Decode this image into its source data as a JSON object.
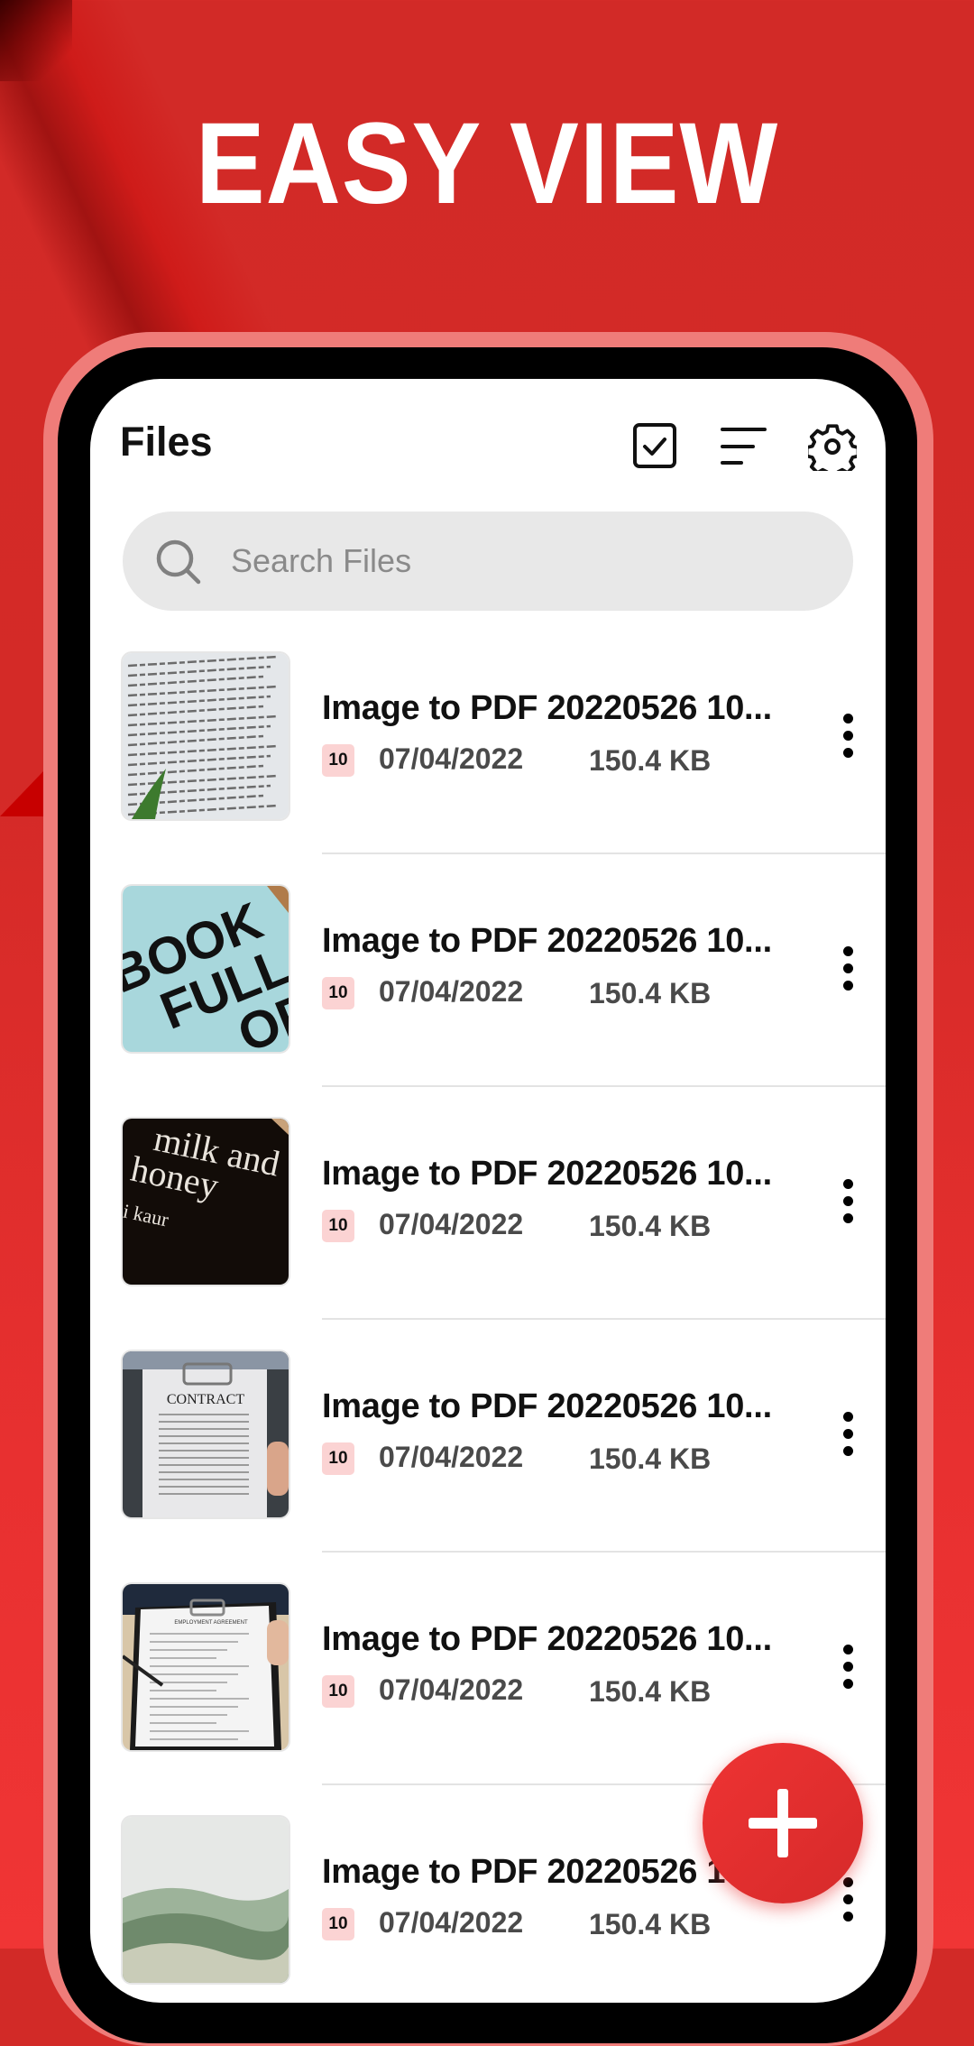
{
  "promo": {
    "headline": "EASY VIEW"
  },
  "app": {
    "title": "Files",
    "toolbar": {
      "select_icon": "checkbox-check-icon",
      "sort_icon": "sort-lines-icon",
      "settings_icon": "gear-icon"
    },
    "search": {
      "placeholder": "Search Files",
      "value": "",
      "icon": "search-icon"
    },
    "files": [
      {
        "name": "Image to PDF 20220526 10...",
        "pages": "10",
        "date": "07/04/2022",
        "size": "150.4 KB",
        "thumbnail": "book-page-text"
      },
      {
        "name": "Image to PDF 20220526 10...",
        "pages": "10",
        "date": "07/04/2022",
        "size": "150.4 KB",
        "thumbnail": "book-full-cover"
      },
      {
        "name": "Image to PDF 20220526 10...",
        "pages": "10",
        "date": "07/04/2022",
        "size": "150.4 KB",
        "thumbnail": "milk-and-honey-cover"
      },
      {
        "name": "Image to PDF 20220526 10...",
        "pages": "10",
        "date": "07/04/2022",
        "size": "150.4 KB",
        "thumbnail": "contract-clipboard"
      },
      {
        "name": "Image to PDF 20220526 10...",
        "pages": "10",
        "date": "07/04/2022",
        "size": "150.4 KB",
        "thumbnail": "employment-agreement"
      },
      {
        "name": "Image to PDF 20220526 10...",
        "pages": "10",
        "date": "07/04/2022",
        "size": "150.4 KB",
        "thumbnail": "green-hills"
      }
    ],
    "thumb_text": {
      "book_line1": "BOOK",
      "book_line2": "FULL",
      "book_line3": "OF",
      "milk_line1": "milk and",
      "milk_line2": "honey",
      "milk_author": "pi kaur",
      "contract": "CONTRACT",
      "employment": "EMPLOYMENT AGREEMENT"
    },
    "fab": {
      "icon": "plus-icon",
      "label": "Add"
    }
  },
  "colors": {
    "brand_red": "#d42a27",
    "fab_red": "#e53030",
    "frame_pink": "#ef7c79",
    "badge_bg": "#fbd3d3"
  }
}
